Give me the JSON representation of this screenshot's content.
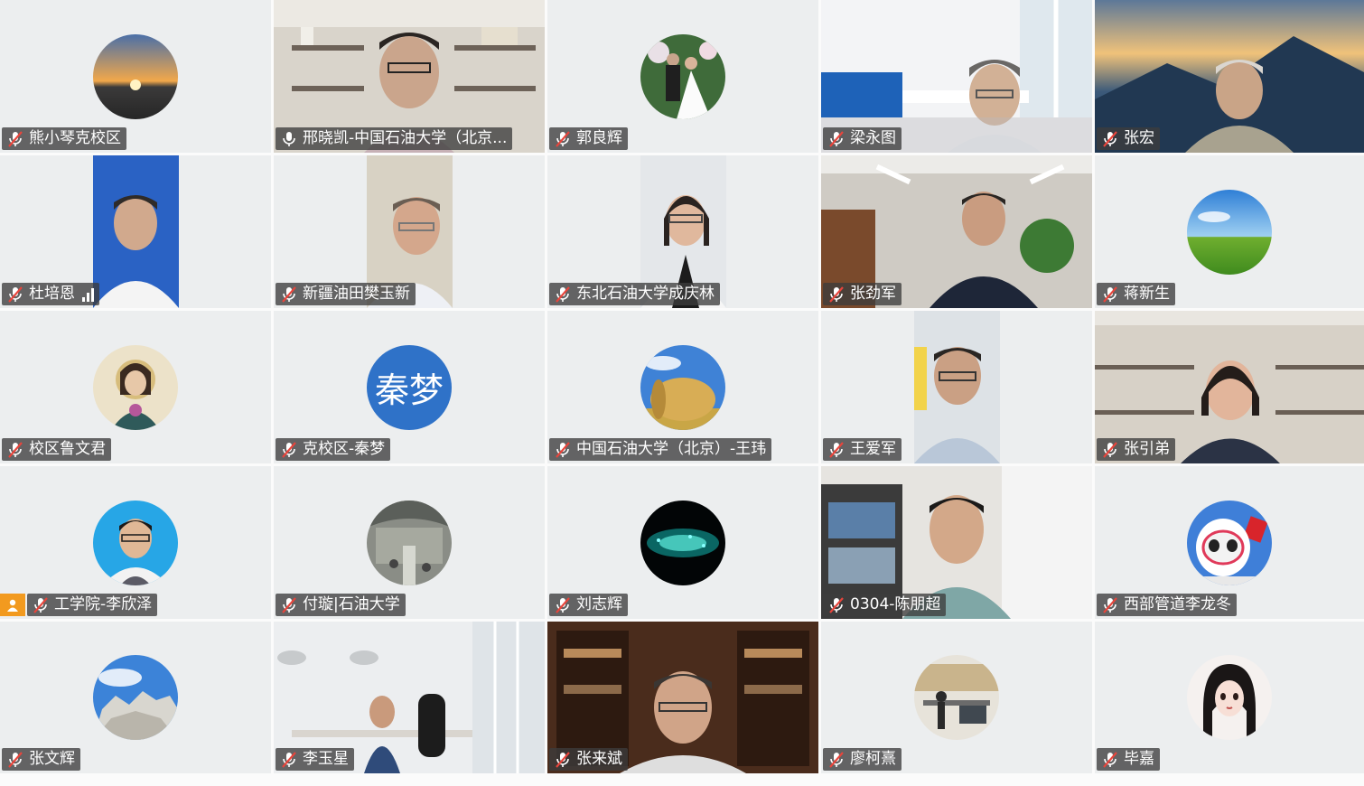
{
  "participants": [
    {
      "name": "熊小琴克校区"
    },
    {
      "name": "邢晓凯-中国石油大学（北京..."
    },
    {
      "name": "郭良辉"
    },
    {
      "name": "梁永图"
    },
    {
      "name": "张宏"
    },
    {
      "name": "杜培恩"
    },
    {
      "name": "新疆油田樊玉新"
    },
    {
      "name": "东北石油大学成庆林"
    },
    {
      "name": "张劲军"
    },
    {
      "name": "蒋新生"
    },
    {
      "name": "校区鲁文君"
    },
    {
      "name": "克校区-秦梦",
      "initials": "秦梦"
    },
    {
      "name": "中国石油大学（北京）-王玮"
    },
    {
      "name": "王爱军"
    },
    {
      "name": "张引弟"
    },
    {
      "name": "工学院-李欣泽"
    },
    {
      "name": "付璇|石油大学"
    },
    {
      "name": "刘志辉"
    },
    {
      "name": "0304-陈朋超"
    },
    {
      "name": "西部管道李龙冬"
    },
    {
      "name": "张文辉"
    },
    {
      "name": "李玉星"
    },
    {
      "name": "张来斌"
    },
    {
      "name": "廖柯熹"
    },
    {
      "name": "毕嘉"
    }
  ],
  "colors": {
    "tile_bg": "#eceeef",
    "label_bg": "#3c3c3c",
    "mute_red": "#e8453c",
    "host_badge": "#f29a1f",
    "initials_bg": "#2f72c8"
  },
  "icons": {
    "muted": "mic-muted-icon",
    "unmuted": "mic-icon",
    "host": "host-person-icon",
    "signal": "signal-bars-icon"
  }
}
